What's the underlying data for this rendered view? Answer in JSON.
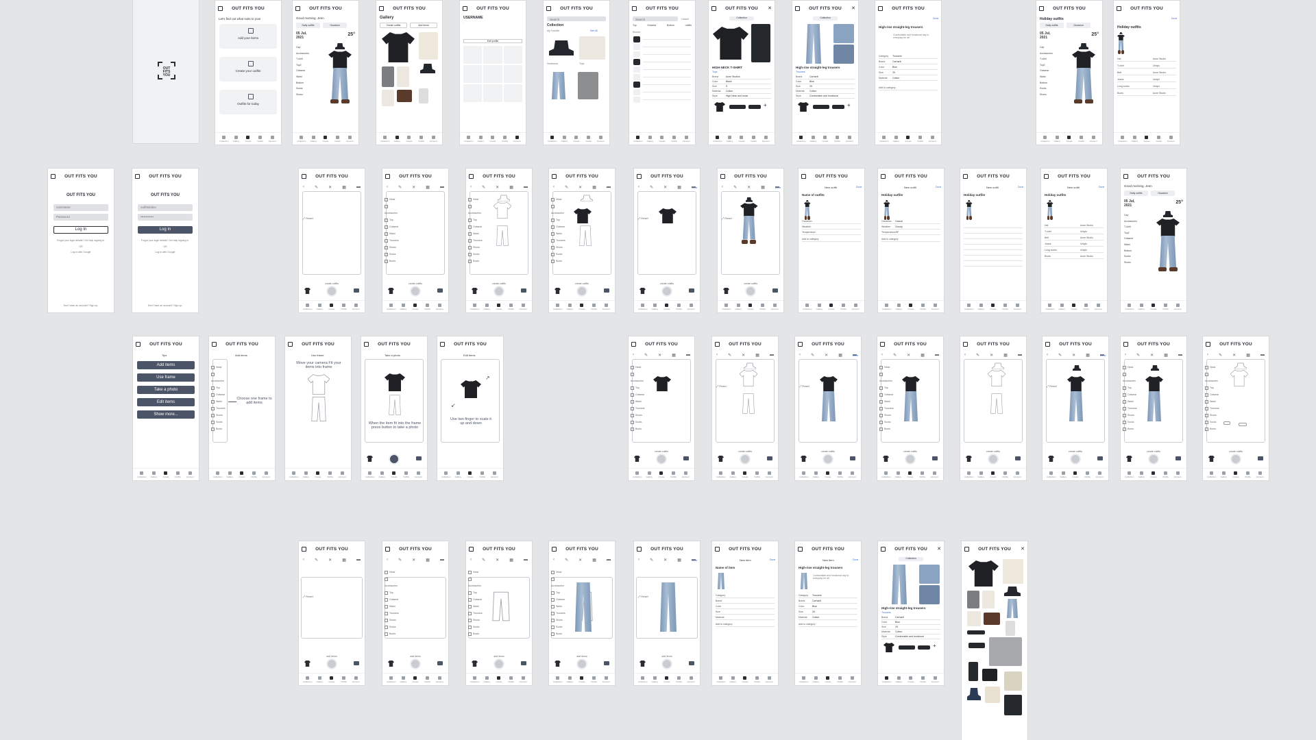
{
  "app": {
    "brand": "OUT FITS YOU",
    "tabs": [
      "Collection",
      "Gallery",
      "Create",
      "Outfits",
      "Account"
    ]
  },
  "splash": {
    "logo_text": "OUT FITS YOU"
  },
  "onboarding": {
    "question": "Let's find out what suits to you!",
    "cards": [
      "Add your items",
      "Create your outfits",
      "Outfits for today"
    ]
  },
  "home": {
    "greeting": "Good morning, Jenn",
    "buttons": [
      "Daily outfits",
      "Occasion"
    ],
    "date_line1": "05 Jul,",
    "date_line2": "2021",
    "temperature": "25°",
    "outfit_items": [
      "Cap",
      "Accessories",
      "T-shirt",
      "Top2",
      "Outwear",
      "Waist",
      "Bottom",
      "Socks",
      "Shoes"
    ]
  },
  "gallery": {
    "title": "Gallery",
    "actions": [
      "Create outfits",
      "Add items"
    ]
  },
  "account": {
    "username": "USERNAME",
    "button": "Edit profile"
  },
  "collection": {
    "header": "Collection",
    "search_placeholder": "Search",
    "cancel": "Cancel",
    "my_favorite": "My Favorite",
    "see_all": "See All",
    "categories": [
      "Headwear",
      "Tops",
      "Bottom",
      "Scarf",
      "Outerwear"
    ],
    "filter_tabs": [
      "Top",
      "Outwear",
      "Bottom",
      "outfits"
    ],
    "recent": "Recent"
  },
  "item_tshirt": {
    "name": "HIGH NECK T-SHIRT",
    "category": "Tops",
    "fields": [
      {
        "k": "Brand",
        "v": "Acne Studios"
      },
      {
        "k": "Color",
        "v": "Black"
      },
      {
        "k": "Size",
        "v": "S"
      },
      {
        "k": "Material",
        "v": "Cotton"
      },
      {
        "k": "Style",
        "v": "High Neck and loose"
      }
    ],
    "note": "with straight jeans to be the best"
  },
  "item_trousers": {
    "name": "High-rise straight-leg trousers",
    "category": "Trousers",
    "fields": [
      {
        "k": "Brand",
        "v": "Carhartt"
      },
      {
        "k": "Color",
        "v": "Blue"
      },
      {
        "k": "Size",
        "v": "25"
      },
      {
        "k": "Material",
        "v": "Cotton"
      },
      {
        "k": "Style",
        "v": "Comfortable and functional"
      }
    ],
    "add_category": "Add to category"
  },
  "edit_item": {
    "done": "Done",
    "description": "Comfortable and functional day to everyday for all",
    "fields": [
      {
        "k": "Category",
        "v": "Trousers"
      },
      {
        "k": "Brand",
        "v": "Carhartt"
      },
      {
        "k": "Color",
        "v": "Blue"
      },
      {
        "k": "Size",
        "v": "25"
      },
      {
        "k": "Material",
        "v": "Cotton"
      }
    ],
    "add_category": "Add to category"
  },
  "holiday": {
    "title": "Holiday outfits",
    "tag": "Casual",
    "columns": [
      {
        "k": "Hat",
        "v": "Acne Studio"
      },
      {
        "k": "T-shirt",
        "v": "Uniqlo"
      },
      {
        "k": "Belt",
        "v": "Acne Studio"
      },
      {
        "k": "Jeans",
        "v": "Uniqlo"
      },
      {
        "k": "Long socks",
        "v": "Uniqlo"
      },
      {
        "k": "Boots",
        "v": "Acne Studio"
      }
    ]
  },
  "login": {
    "username_placeholder": "Username",
    "password_placeholder": "Password",
    "username_filled": "outfitsindex",
    "password_filled": "••••••••••••",
    "button": "Log In",
    "forgot": "Forgot your login details? Get help signing in.",
    "or": "OR",
    "google": "Log in with Google",
    "signup": "Don't have an account? Sign up."
  },
  "tips": {
    "title": "Tips",
    "buttons": [
      "Add items",
      "Use frame",
      "Take a photo",
      "Edit items",
      "Show more..."
    ]
  },
  "tip_add": {
    "title": "Add items",
    "note": "Choose one frame to add items"
  },
  "tip_frame": {
    "title": "Use frame",
    "note": "Move your camera Fit your items into frame"
  },
  "tip_photo": {
    "title": "Take a photo",
    "note": "When the item fit into the frame press button to take a photo"
  },
  "tip_edit": {
    "title": "Edit items",
    "note": "Use two finger to scale it up and down"
  },
  "create": {
    "create_outfits": "create outfits",
    "add_items": "add items",
    "done": "Done",
    "new_outfit": "New outfit",
    "new_item": "New item",
    "name_outfit": "Name of outfits",
    "name_item": "Name of item",
    "side_items": [
      "Head",
      "Accessories",
      "Top",
      "Outwear",
      "Waist",
      "Trousers",
      "Shoes",
      "Socks",
      "Boots"
    ],
    "outfit_fields": [
      {
        "k": "Occasion",
        "v": "Casual"
      },
      {
        "k": "Weather",
        "v": "Cloudy"
      },
      {
        "k": "Temperature",
        "v": "25°"
      }
    ]
  }
}
